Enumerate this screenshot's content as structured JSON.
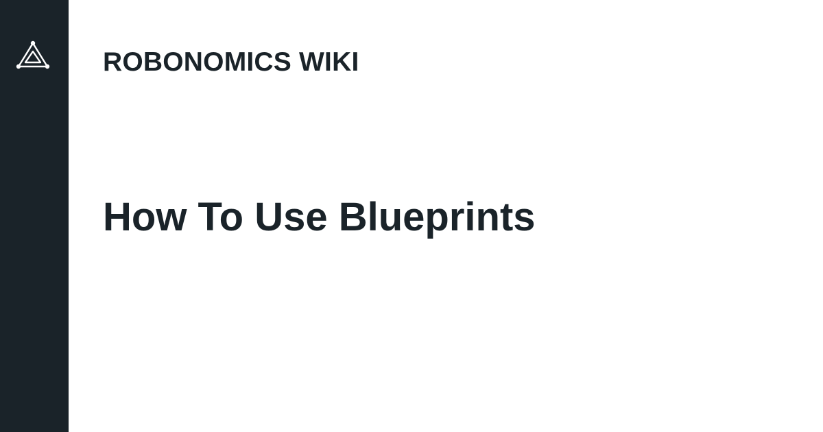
{
  "brand": {
    "logo_icon": "triangle-network-icon",
    "site_name": "ROBONOMICS WIKI"
  },
  "page": {
    "title": "How To Use Blueprints"
  },
  "colors": {
    "sidebar": "#1a2329",
    "text": "#1a2329",
    "background": "#ffffff",
    "logo": "#ffffff"
  }
}
